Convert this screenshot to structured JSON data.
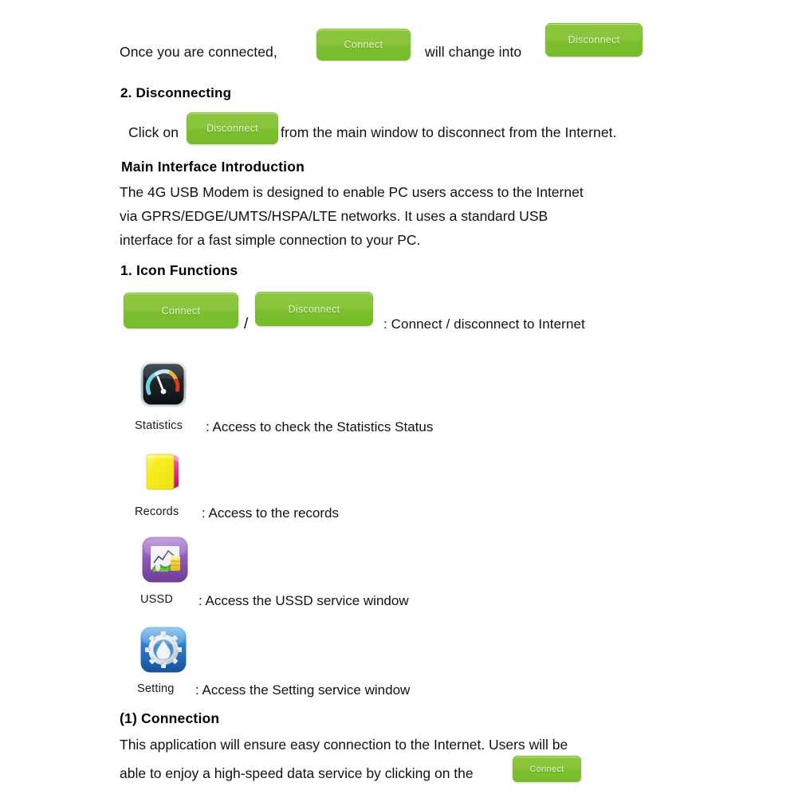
{
  "document": {
    "line1": {
      "before_button": "Once you are connected,",
      "middle_text": "will change into",
      "connect_label": "Connect",
      "disconnect_label": "Disconnect"
    },
    "section_disconnecting": {
      "heading": "2. Disconnecting",
      "click_on": "Click on",
      "disconnect_label": "Disconnect",
      "after_button": "from the main window to disconnect from the Internet."
    },
    "section_main_interface": {
      "heading": "Main Interface Introduction",
      "paragraph_lines": [
        "The 4G USB Modem is designed to enable PC users access to the Internet",
        "via GPRS/EDGE/UMTS/HSPA/LTE networks. It uses a standard USB",
        "interface for a fast simple connection to your PC."
      ]
    },
    "section_icon_functions": {
      "heading": "1. Icon Functions",
      "connect_label": "Connect",
      "disconnect_label": "Disconnect",
      "separator": "/",
      "connect_description": ": Connect / disconnect to Internet",
      "icons": [
        {
          "name": "statistics",
          "label": "Statistics",
          "description": ": Access to check the Statistics Status"
        },
        {
          "name": "records",
          "label": "Records",
          "description": ": Access to the records"
        },
        {
          "name": "ussd",
          "label": "USSD",
          "description": ": Access the USSD service window"
        },
        {
          "name": "setting",
          "label": "Setting",
          "description": ": Access the Setting service window"
        }
      ]
    },
    "section_connection": {
      "heading": "(1) Connection",
      "paragraph_line1": "This application will ensure easy connection to the Internet. Users will be",
      "paragraph_line2": "able to enjoy a high-speed data service by clicking on the",
      "connect_label": "Connect"
    }
  },
  "colors": {
    "button_green_top": "#8dc63f",
    "button_green_bottom": "#76bc28",
    "button_text": "#eaf6da",
    "body_text": "#111111",
    "page_background": "#ffffff",
    "statistics_tile": "#1d2328",
    "records_paper": "#f5ec20",
    "records_edge": "#e0218a",
    "ussd_tile": "#8e5ab8",
    "setting_tile": "#2f7fd1"
  }
}
